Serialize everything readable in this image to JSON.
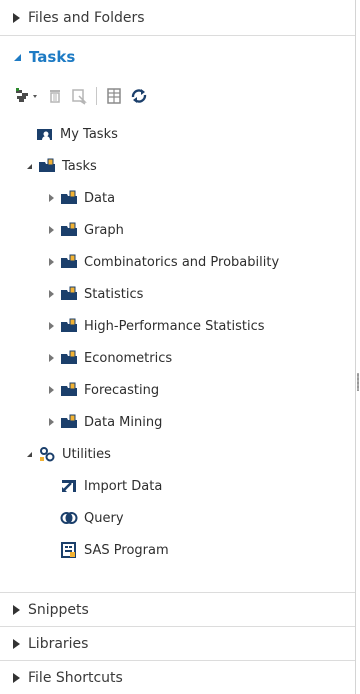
{
  "panel": {
    "sections_top": [
      {
        "label": "Files and Folders"
      }
    ],
    "tasks": {
      "header": "Tasks",
      "toolbar": [
        "new-task-menu-icon",
        "delete-icon",
        "properties-icon",
        "properties-grid-icon",
        "refresh-icon"
      ],
      "tree": {
        "my_tasks": "My Tasks",
        "tasks_root": "Tasks",
        "task_folders": [
          "Data",
          "Graph",
          "Combinatorics and Probability",
          "Statistics",
          "High-Performance Statistics",
          "Econometrics",
          "Forecasting",
          "Data Mining"
        ],
        "utilities": "Utilities",
        "utility_items": [
          "Import Data",
          "Query",
          "SAS Program"
        ]
      }
    },
    "sections_bottom": [
      {
        "label": "Snippets"
      },
      {
        "label": "Libraries"
      },
      {
        "label": "File Shortcuts"
      }
    ]
  },
  "colors": {
    "accent": "#1e7bc4",
    "folder": "#1b3f6b",
    "text": "#333333"
  }
}
